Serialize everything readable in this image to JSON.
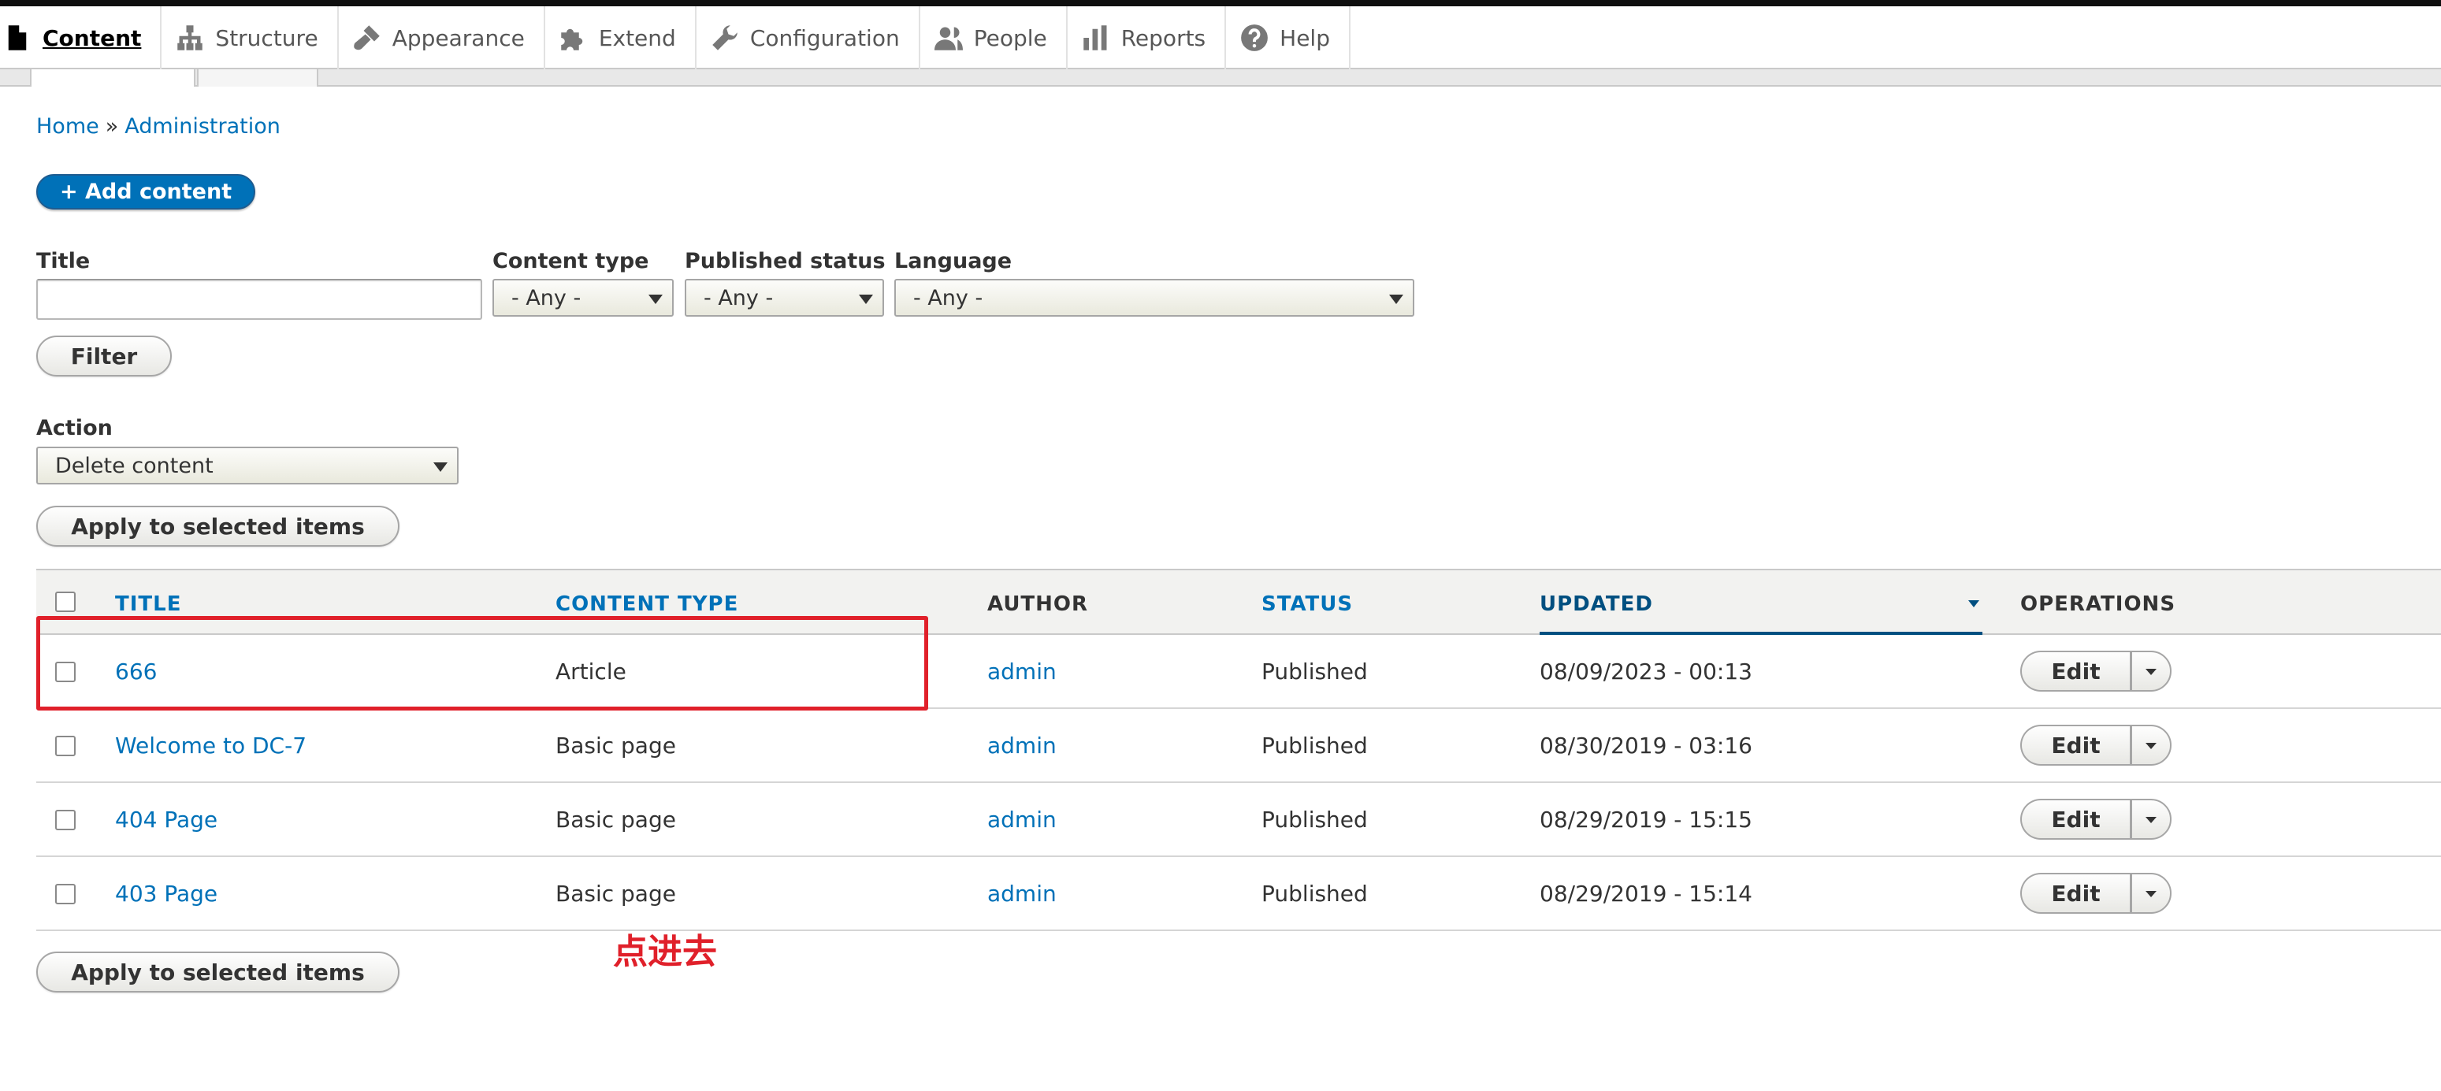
{
  "toolbar": {
    "items": [
      {
        "label": "Content",
        "icon": "page-icon",
        "active": true
      },
      {
        "label": "Structure",
        "icon": "sitemap-icon"
      },
      {
        "label": "Appearance",
        "icon": "paintbrush-icon"
      },
      {
        "label": "Extend",
        "icon": "puzzle-icon"
      },
      {
        "label": "Configuration",
        "icon": "wrench-icon"
      },
      {
        "label": "People",
        "icon": "people-icon"
      },
      {
        "label": "Reports",
        "icon": "bar-chart-icon"
      },
      {
        "label": "Help",
        "icon": "help-icon"
      }
    ]
  },
  "breadcrumb": {
    "home": "Home",
    "separator": "»",
    "admin": "Administration"
  },
  "add_content": {
    "label": "+ Add content"
  },
  "filters": {
    "title_label": "Title",
    "title_value": "",
    "content_type_label": "Content type",
    "content_type_value": "- Any -",
    "published_label": "Published status",
    "published_value": "- Any -",
    "language_label": "Language",
    "language_value": "- Any -",
    "filter_button": "Filter"
  },
  "action": {
    "label": "Action",
    "value": "Delete content",
    "apply_button": "Apply to selected items"
  },
  "table": {
    "headers": {
      "title": "TITLE",
      "content_type": "CONTENT TYPE",
      "author": "AUTHOR",
      "status": "STATUS",
      "updated": "UPDATED",
      "operations": "OPERATIONS"
    },
    "rows": [
      {
        "title": "666",
        "content_type": "Article",
        "author": "admin",
        "status": "Published",
        "updated": "08/09/2023 - 00:13",
        "edit": "Edit"
      },
      {
        "title": "Welcome to DC-7",
        "content_type": "Basic page",
        "author": "admin",
        "status": "Published",
        "updated": "08/30/2019 - 03:16",
        "edit": "Edit"
      },
      {
        "title": "404 Page",
        "content_type": "Basic page",
        "author": "admin",
        "status": "Published",
        "updated": "08/29/2019 - 15:15",
        "edit": "Edit"
      },
      {
        "title": "403 Page",
        "content_type": "Basic page",
        "author": "admin",
        "status": "Published",
        "updated": "08/29/2019 - 15:14",
        "edit": "Edit"
      }
    ]
  },
  "bottom_apply_button": "Apply to selected items",
  "annotation": {
    "text": "点进去",
    "color": "#e0202a"
  },
  "colors": {
    "link": "#0071b8",
    "primary_button": "#0071b8",
    "annotation": "#e0202a"
  }
}
